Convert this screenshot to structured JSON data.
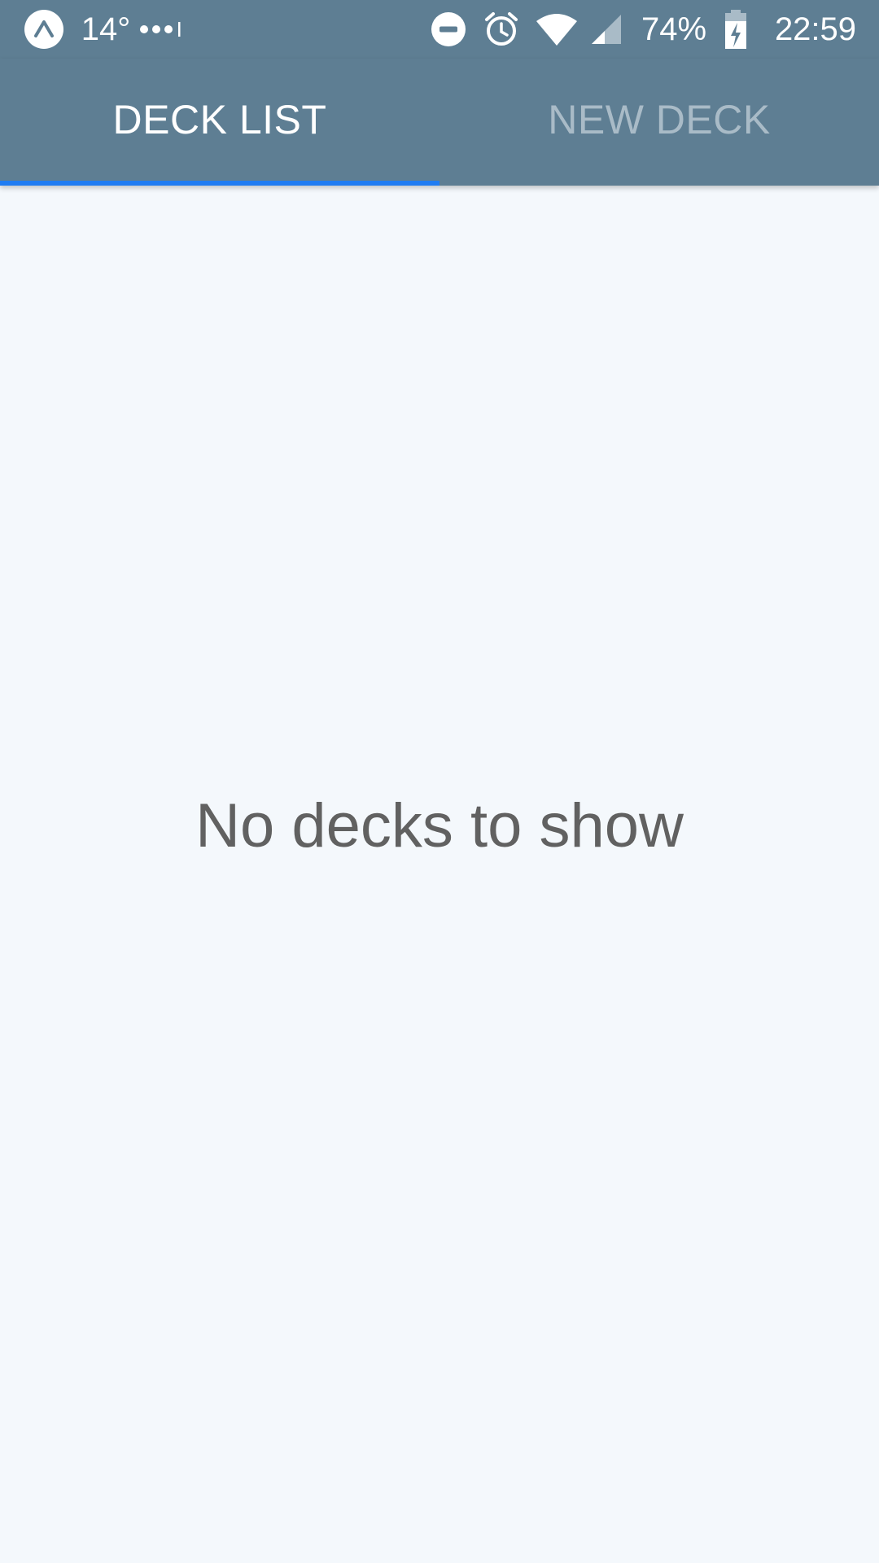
{
  "status_bar": {
    "temperature": "14°",
    "more_notifications_icon": "more-dots-icon",
    "app_icon": "expo-app-icon",
    "dnd_icon": "do-not-disturb-icon",
    "alarm_icon": "alarm-icon",
    "wifi_icon": "wifi-icon",
    "signal_icon": "cell-signal-icon",
    "battery_percent": "74%",
    "battery_icon": "battery-charging-icon",
    "time": "22:59"
  },
  "tabs": [
    {
      "label": "DECK LIST",
      "active": true
    },
    {
      "label": "NEW DECK",
      "active": false
    }
  ],
  "main": {
    "empty_message": "No decks to show"
  },
  "colors": {
    "header": "#5e7e93",
    "indicator": "#1f7cf2",
    "background": "#f4f8fc",
    "active_tab_text": "#ffffff",
    "inactive_tab_text": "#a9bbc7",
    "message_text": "#616161"
  }
}
